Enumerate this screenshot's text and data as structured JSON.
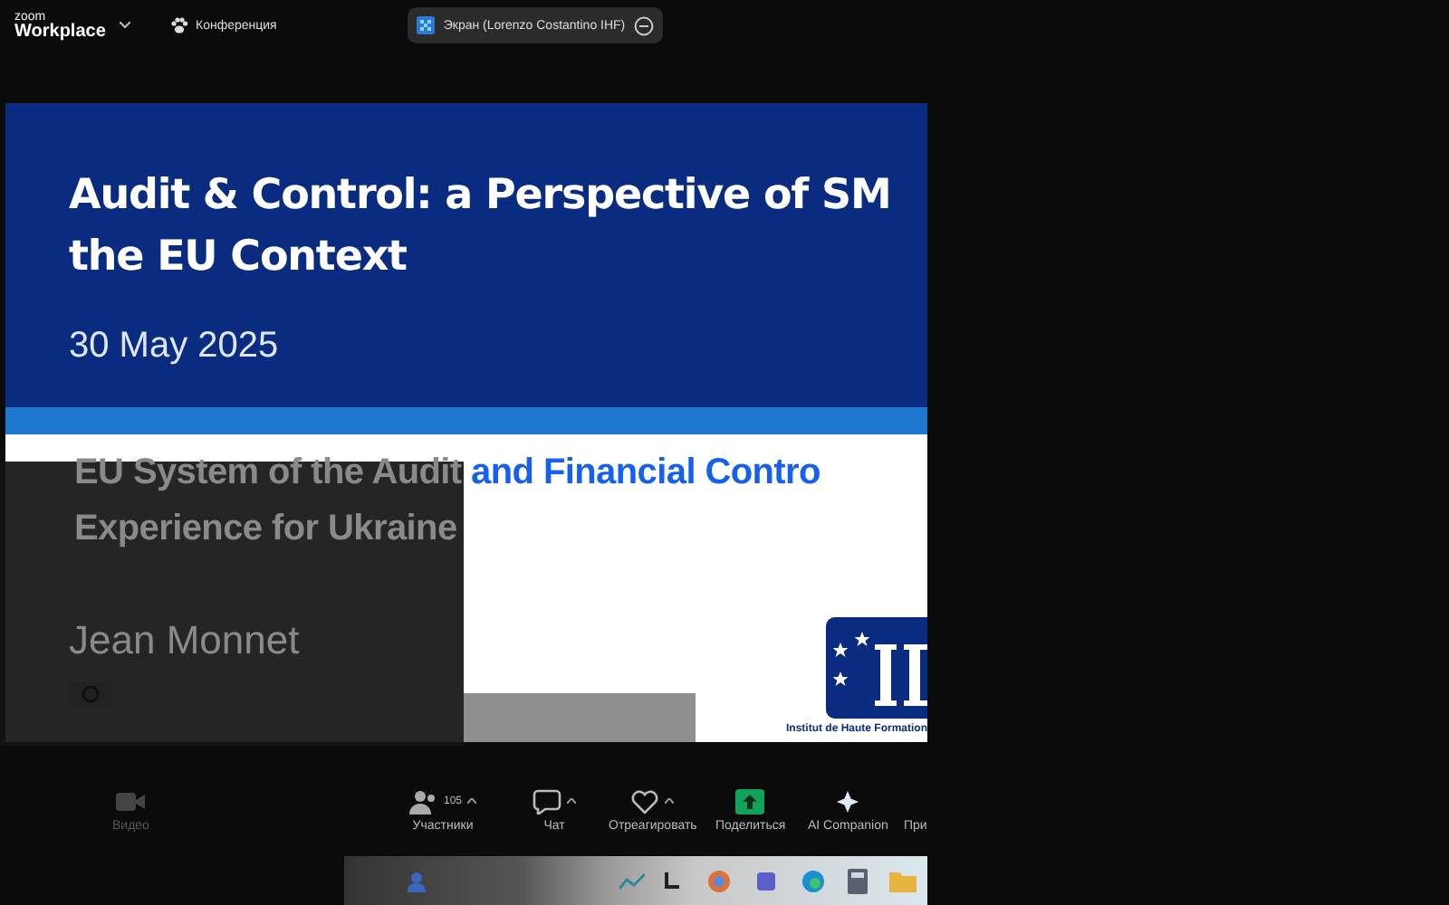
{
  "topbar": {
    "brand_small": "zoom",
    "brand": "Workplace",
    "meeting_label": "Конференция",
    "share_pill": "Экран (Lorenzo Costantino IHF)"
  },
  "slide": {
    "title_lines": [
      "Audit & Control: a Perspective of SM",
      "the EU Context"
    ],
    "date": "30 May 2025",
    "subtitle_lines": [
      "EU System of the Audit and Financial Contro",
      "Experience for Ukraine"
    ],
    "author": "Jean Monnet",
    "logo_caption": "Institut de Haute Formation"
  },
  "toolbar": [
    {
      "kind": "video",
      "label": "Видео"
    },
    {
      "kind": "participants",
      "label": "Участники",
      "count": "105"
    },
    {
      "kind": "chat",
      "label": "Чат"
    },
    {
      "kind": "react",
      "label": "Отреагировать"
    },
    {
      "kind": "share",
      "label": "Поделиться"
    },
    {
      "kind": "ai",
      "label": "AI Companion"
    },
    {
      "kind": "more",
      "label": "При"
    }
  ]
}
